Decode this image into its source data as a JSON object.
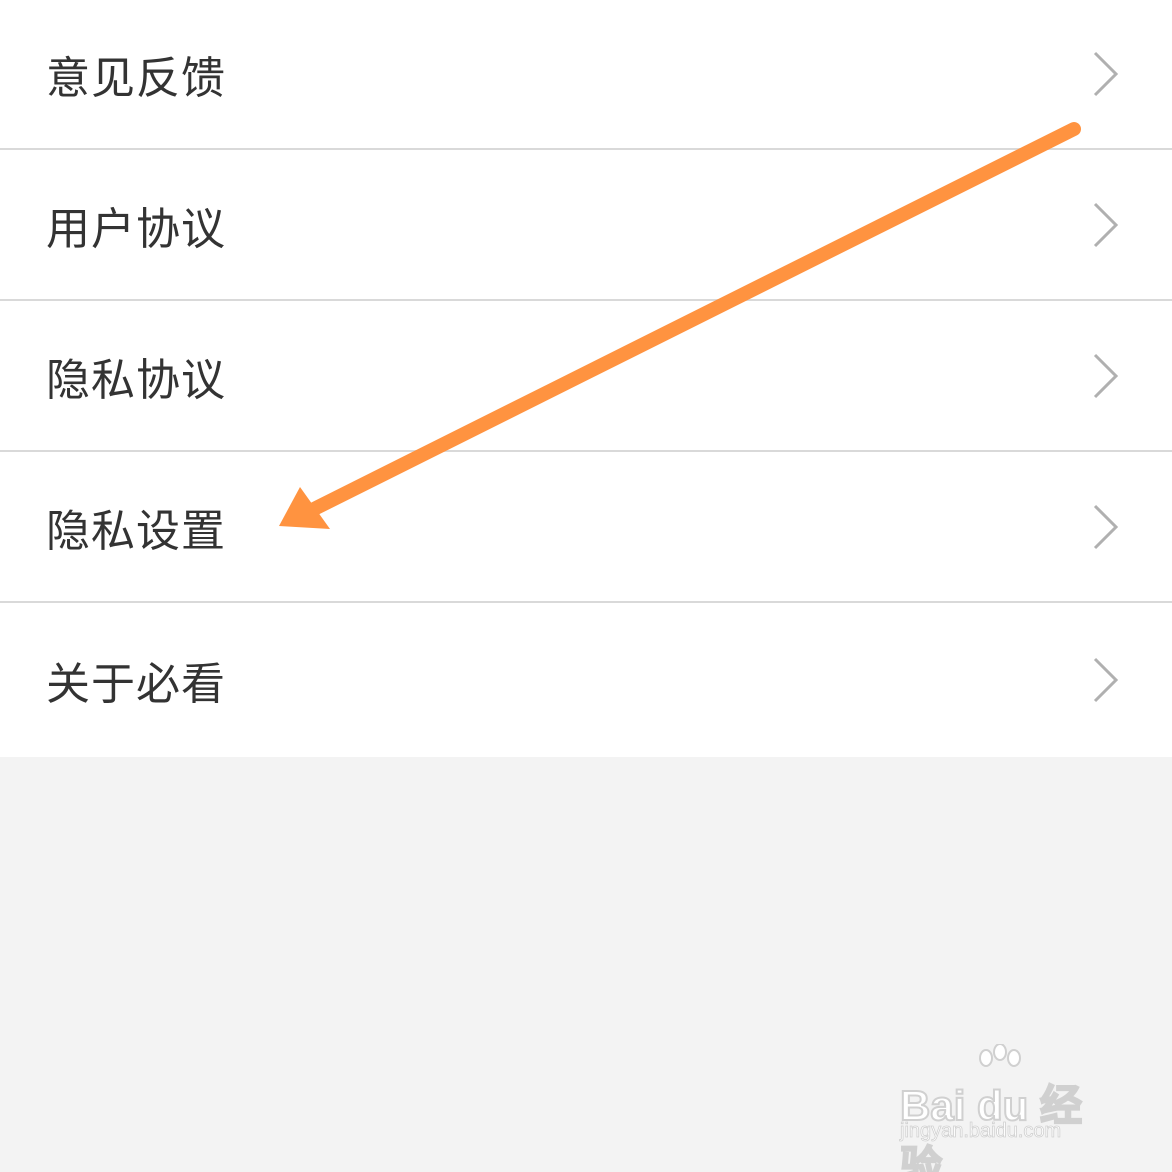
{
  "menu": {
    "items": [
      {
        "label": "意见反馈",
        "icon": "chevron-right-icon"
      },
      {
        "label": "用户协议",
        "icon": "chevron-right-icon"
      },
      {
        "label": "隐私协议",
        "icon": "chevron-right-icon"
      },
      {
        "label": "隐私设置",
        "icon": "chevron-right-icon"
      },
      {
        "label": "关于必看",
        "icon": "chevron-right-icon"
      }
    ]
  },
  "annotation": {
    "type": "arrow",
    "points_to": "隐私设置",
    "color": "#ff9340"
  },
  "watermark": {
    "brand": "Bai du 经验",
    "url": "jingyan.baidu.com"
  },
  "colors": {
    "background": "#f3f3f3",
    "row_background": "#ffffff",
    "divider": "#d9d9d9",
    "text": "#333333",
    "chevron": "#b0b0b0",
    "arrow": "#ff9340"
  }
}
